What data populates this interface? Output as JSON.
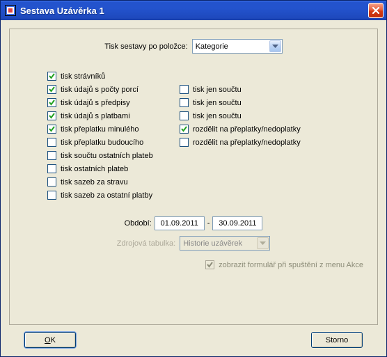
{
  "window": {
    "title": "Sestava Uzávěrka 1"
  },
  "top": {
    "label": "Tisk sestavy po položce:",
    "combo_value": "Kategorie"
  },
  "checks": {
    "r0": {
      "a_label": "tisk strávníků",
      "a_checked": true
    },
    "r1": {
      "a_label": "tisk údajů s počty porcí",
      "a_checked": true,
      "b_label": "tisk jen součtu",
      "b_checked": false
    },
    "r2": {
      "a_label": "tisk údajů s předpisy",
      "a_checked": true,
      "b_label": "tisk jen součtu",
      "b_checked": false
    },
    "r3": {
      "a_label": "tisk údajů s platbami",
      "a_checked": true,
      "b_label": "tisk jen součtu",
      "b_checked": false
    },
    "r4": {
      "a_label": "tisk přeplatku minulého",
      "a_checked": true,
      "b_label": "rozdělit na přeplatky/nedoplatky",
      "b_checked": true
    },
    "r5": {
      "a_label": "tisk přeplatku budoucího",
      "a_checked": false,
      "b_label": "rozdělit na přeplatky/nedoplatky",
      "b_checked": false
    },
    "r6": {
      "a_label": "tisk součtu ostatních plateb",
      "a_checked": false
    },
    "r7": {
      "a_label": "tisk ostatních plateb",
      "a_checked": false
    },
    "r8": {
      "a_label": "tisk sazeb za stravu",
      "a_checked": false
    },
    "r9": {
      "a_label": "tisk sazeb za ostatní platby",
      "a_checked": false
    }
  },
  "period": {
    "label": "Období:",
    "from": "01.09.2011",
    "sep": "-",
    "to": "30.09.2011"
  },
  "source": {
    "label": "Zdrojová tabulka:",
    "combo_value": "Historie uzávěrek"
  },
  "showform": {
    "label": "zobrazit formulář při spuštění z menu Akce",
    "checked": true
  },
  "buttons": {
    "ok_u": "O",
    "ok_rest": "K",
    "cancel": "Storno"
  }
}
